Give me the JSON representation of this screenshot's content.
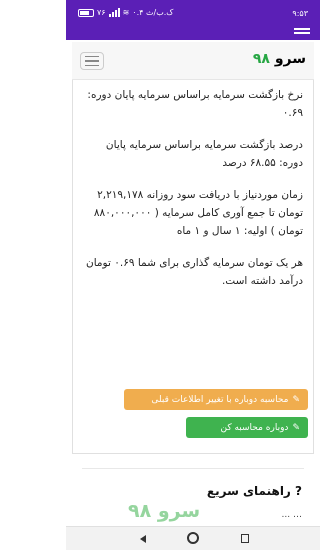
{
  "status_bar": {
    "time": "۹:۵۳",
    "network_speed": "۰.۴ ک.ب/ث",
    "battery": "۷۶"
  },
  "header": {
    "brand_text": "سرو",
    "brand_number": "۹۸"
  },
  "results": {
    "para1": "نرخ بازگشت سرمایه براساس سرمایه پایان دوره: ۰.۶۹",
    "para2": "درصد بازگشت سرمایه براساس سرمایه پایان دوره: ۶۸.۵۵ درصد",
    "para3": "زمان موردنیاز با دریافت سود روزانه ۲,۲۱۹,۱۷۸ تومان تا جمع آوری کامل سرمایه ( ۸۸۰,۰۰۰,۰۰۰ تومان ) اولیه: ۱ سال و ۱ ماه",
    "para4": "هر یک تومان سرمایه گذاری برای شما ۰.۶۹ تومان درآمد داشته است."
  },
  "buttons": {
    "recalc_with_prev": "محاسبه دوباره با تغییر اطلاعات قبلی",
    "recalc": "دوباره محاسبه کن"
  },
  "guide": {
    "title": "راهنمای سریع",
    "subtitle": "… ..."
  },
  "watermark": "سرو ۹۸"
}
